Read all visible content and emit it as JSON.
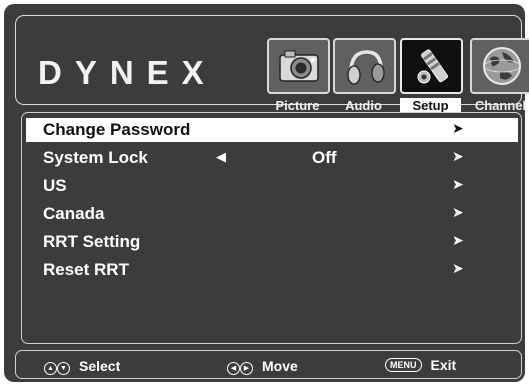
{
  "brand": "DYNEX",
  "tabs": [
    {
      "label": "Picture",
      "icon": "camera-icon"
    },
    {
      "label": "Audio",
      "icon": "headphones-icon"
    },
    {
      "label": "Setup",
      "icon": "gear-icon",
      "active": true
    },
    {
      "label": "Channel",
      "icon": "globe-icon"
    }
  ],
  "menu": {
    "items": [
      {
        "label": "Change Password",
        "selected": true
      },
      {
        "label": "System Lock",
        "value": "Off"
      },
      {
        "label": "US"
      },
      {
        "label": "Canada"
      },
      {
        "label": "RRT Setting"
      },
      {
        "label": "Reset RRT"
      }
    ]
  },
  "footer": {
    "select": "Select",
    "move": "Move",
    "menu_key": "MENU",
    "exit": "Exit"
  },
  "colors": {
    "panel": "#3c3c3c",
    "highlight": "#ffffff",
    "text": "#ffffff"
  }
}
